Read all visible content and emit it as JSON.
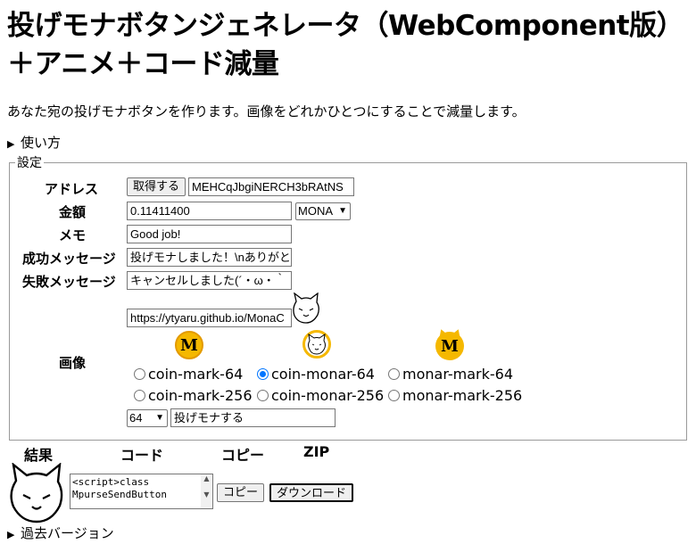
{
  "page": {
    "title_line1": "投げモナボタンジェネレータ（WebComponent版）",
    "title_line2": "＋アニメ＋コード減量",
    "intro": "あなた宛の投げモナボタンを作ります。画像をどれかひとつにすることで減量します。"
  },
  "usage": {
    "label": "使い方"
  },
  "settings": {
    "legend": "設定",
    "address": {
      "label": "アドレス",
      "fetch_button": "取得する",
      "value": "MEHCqJbgiNERCH3bRAtNS"
    },
    "amount": {
      "label": "金額",
      "value": "0.11411400",
      "unit": "MONA"
    },
    "memo": {
      "label": "メモ",
      "value": "Good job!"
    },
    "success": {
      "label": "成功メッセージ",
      "value": "投げモナしました！\\nありがと"
    },
    "failure": {
      "label": "失敗メッセージ",
      "value": "キャンセルしました(´・ω・｀"
    },
    "image": {
      "label": "画像",
      "url": "https://ytyaru.github.io/MonaC",
      "coin_glyph": "M",
      "options": [
        {
          "label": "coin-mark-64",
          "checked": false
        },
        {
          "label": "coin-monar-64",
          "checked": true
        },
        {
          "label": "monar-mark-64",
          "checked": false
        },
        {
          "label": "coin-mark-256",
          "checked": false
        },
        {
          "label": "coin-monar-256",
          "checked": false
        },
        {
          "label": "monar-mark-256",
          "checked": false
        }
      ],
      "size": "64",
      "button_text": "投げモナする"
    }
  },
  "result": {
    "headers": [
      "結果",
      "コード",
      "コピー",
      "ZIP"
    ],
    "code_value": "<script>class\nMpurseSendButton",
    "copy_button": "コピー",
    "download_button": "ダウンロード"
  },
  "past": {
    "label": "過去バージョン"
  },
  "colors": {
    "coin": "#f5b800",
    "coin_border": "#e39a00",
    "radio_accent": "#0075ff"
  }
}
